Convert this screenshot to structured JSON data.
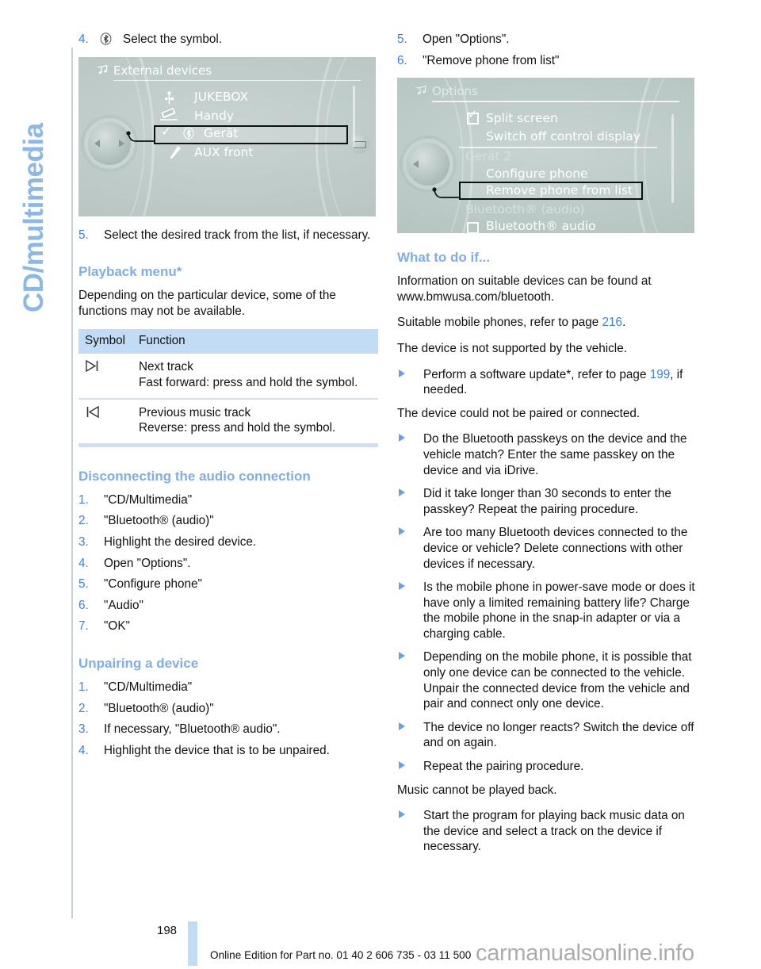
{
  "sidebar": {
    "chapter_label": "CD/multimedia"
  },
  "left_column": {
    "step4": {
      "num": "4.",
      "glyph": "bluetooth-symbol",
      "text": "Select the symbol."
    },
    "screenshot1": {
      "title": "External devices",
      "title_icon": "multimedia-icon",
      "rows": [
        {
          "icon": "usb-icon",
          "label": "JUKEBOX"
        },
        {
          "icon": "phone-icon",
          "label": "Handy"
        },
        {
          "icon": "bluetooth-icon",
          "label": "Gerät",
          "checked": true,
          "selected": true
        },
        {
          "icon": "aux-pen-icon",
          "label": "AUX front"
        }
      ]
    },
    "step5": {
      "num": "5.",
      "text": "Select the desired track from the list, if necessary."
    },
    "playback_heading": "Playback menu*",
    "playback_intro": "Depending on the particular device, some of the functions may not be available.",
    "table": {
      "headers": [
        "Symbol",
        "Function"
      ],
      "rows": [
        {
          "symbol": "next-track-icon",
          "lines": [
            "Next track",
            "Fast forward: press and hold the symbol."
          ]
        },
        {
          "symbol": "previous-track-icon",
          "lines": [
            "Previous music track",
            "Reverse: press and hold the symbol."
          ]
        }
      ]
    },
    "disconnect_heading": "Disconnecting the audio connection",
    "disconnect_steps": [
      "\"CD/Multimedia\"",
      "\"Bluetooth® (audio)\"",
      "Highlight the desired device.",
      "Open \"Options\".",
      "\"Configure phone\"",
      "\"Audio\"",
      "\"OK\""
    ],
    "unpair_heading": "Unpairing a device",
    "unpair_steps": [
      "\"CD/Multimedia\"",
      "\"Bluetooth® (audio)\"",
      "If necessary, \"Bluetooth® audio\".",
      "Highlight the device that is to be unpaired."
    ]
  },
  "right_column": {
    "step5": {
      "num": "5.",
      "text": "Open \"Options\"."
    },
    "step6": {
      "num": "6.",
      "text": "\"Remove phone from list\""
    },
    "screenshot2": {
      "title": "Options",
      "title_icon": "multimedia-icon",
      "rows": [
        {
          "label": "Split screen",
          "checkbox": "checked"
        },
        {
          "label": "Switch off control display"
        },
        {
          "label": "Gerät 2",
          "group": true
        },
        {
          "label": "Configure phone"
        },
        {
          "label": "Remove phone from list",
          "selected": true
        },
        {
          "label": "Bluetooth® (audio)",
          "group": true
        },
        {
          "label": "Bluetooth® audio",
          "checkbox": "unchecked"
        }
      ]
    },
    "what_heading": "What to do if...",
    "para1_a": "Information on suitable devices can be found at",
    "para1_b": "www.bmwusa.com/bluetooth.",
    "para2_pre": "Suitable mobile phones, refer to page ",
    "para2_page": "216",
    "para2_post": ".",
    "para3": "The device is not supported by the vehicle.",
    "bullet1_pre": "Perform a software update*, refer to page ",
    "bullet1_page": "199",
    "bullet1_post": ", if needed.",
    "para4": "The device could not be paired or connected.",
    "bullets": [
      "Do the Bluetooth passkeys on the device and the vehicle match? Enter the same passkey on the device and via iDrive.",
      "Did it take longer than 30 seconds to enter the passkey? Repeat the pairing procedure.",
      "Are too many Bluetooth devices connected to the device or vehicle? Delete connections with other devices if necessary.",
      "Is the mobile phone in power-save mode or does it have only a limited remaining battery life? Charge the mobile phone in the snap-in adapter or via a charging cable.",
      "Depending on the mobile phone, it is possible that only one device can be connected to the vehicle. Unpair the connected device from the vehicle and pair and connect only one device.",
      "The device no longer reacts? Switch the device off and on again.",
      "Repeat the pairing procedure."
    ],
    "para5": "Music cannot be played back.",
    "bullet_last": "Start the program for playing back music data on the device and select a track on the device if necessary."
  },
  "footer": {
    "page_number": "198",
    "edition_text": "Online Edition for Part no. 01 40 2 606 735 - 03 11 500",
    "watermark": "carmanualsonline.info"
  },
  "colors": {
    "accent_blue": "#7eaee4",
    "link_blue": "#3b7fe0",
    "table_header_bg": "#c3dcf5",
    "idrive_bg": "#b9c6c4"
  }
}
